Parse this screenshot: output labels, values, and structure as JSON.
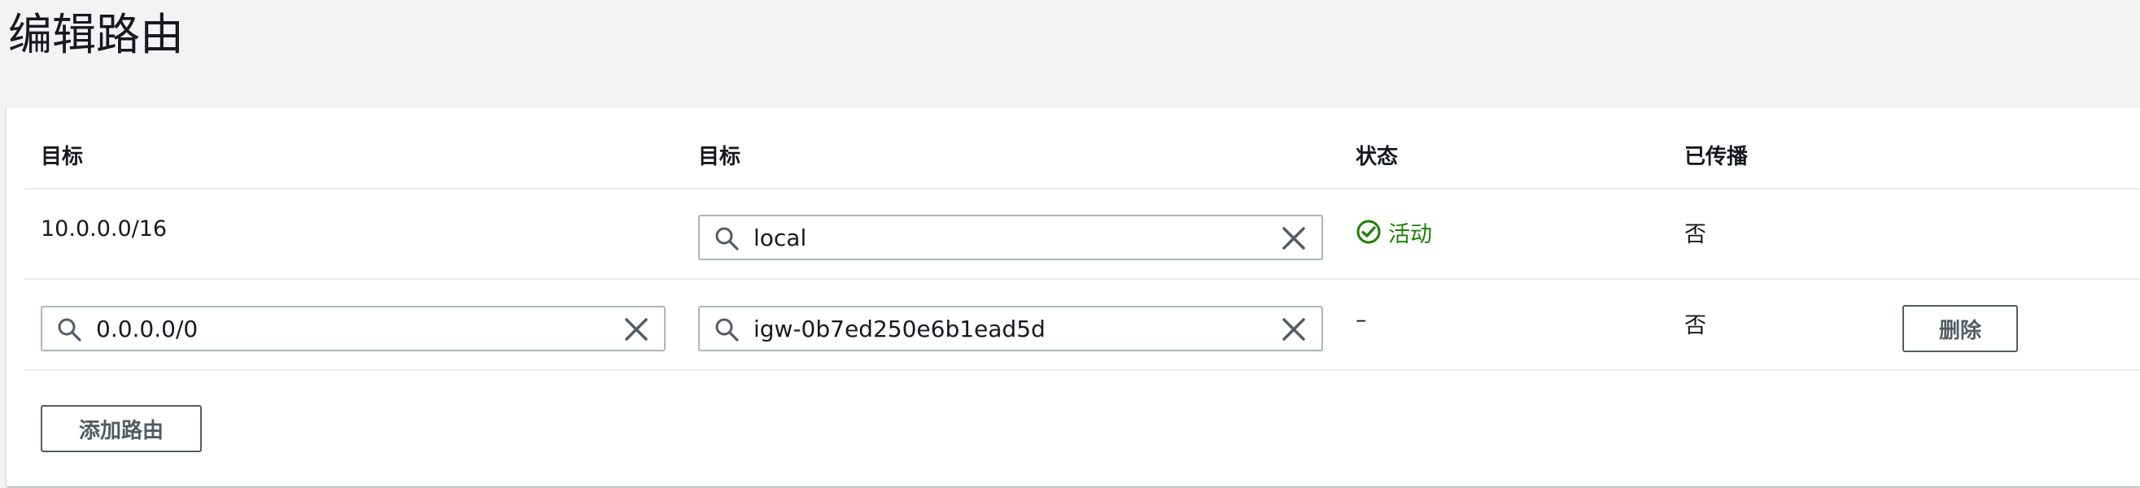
{
  "page": {
    "title": "编辑路由"
  },
  "table": {
    "headers": [
      "目标",
      "目标",
      "状态",
      "已传播"
    ],
    "rows": [
      {
        "destination": "10.0.0.0/16",
        "target": "local",
        "status": "活动",
        "propagated": "否"
      },
      {
        "destination": "0.0.0.0/0",
        "target": "igw-0b7ed250e6b1ead5d",
        "status": "–",
        "propagated": "否",
        "remove_label": "删除"
      }
    ]
  },
  "actions": {
    "add_route_label": "添加路由"
  },
  "icons": {
    "search": "search-icon",
    "clear": "clear-icon",
    "status_ok": "check-circle-icon"
  },
  "colors": {
    "success": "#1d8102",
    "border": "#aab7b8",
    "button_text": "#545b64",
    "background": "#f2f3f3"
  }
}
